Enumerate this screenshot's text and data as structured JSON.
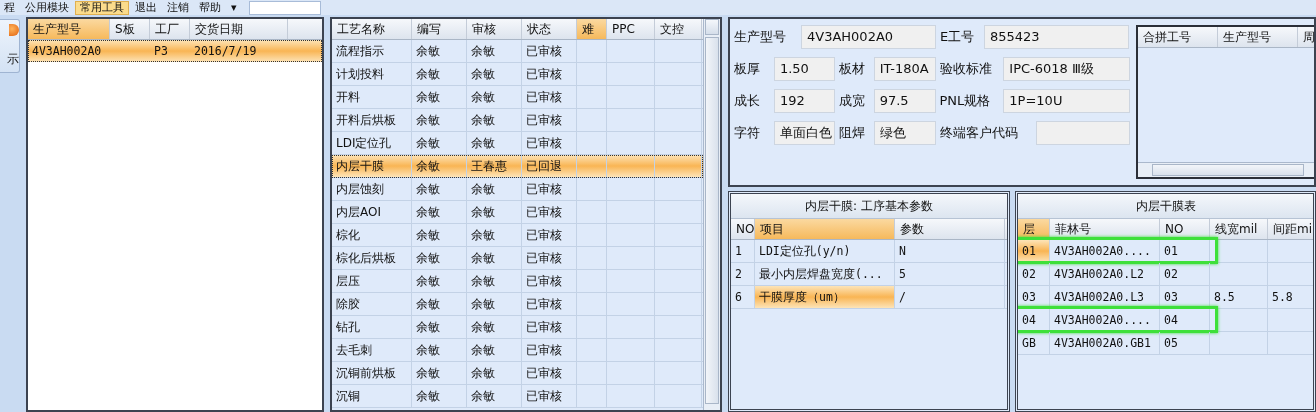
{
  "menu": {
    "items": [
      {
        "label": "程",
        "selected": false
      },
      {
        "label": "公用模块",
        "selected": false
      },
      {
        "label": "常用工具",
        "selected": true
      },
      {
        "label": "退出",
        "selected": false
      },
      {
        "label": "注销",
        "selected": false
      },
      {
        "label": "帮助",
        "selected": false
      }
    ],
    "more": "▾"
  },
  "side_button": {
    "label": "示"
  },
  "orders": {
    "columns": [
      {
        "label": "生产型号",
        "selected": true
      },
      {
        "label": "S板",
        "selected": false
      },
      {
        "label": "工厂",
        "selected": false
      },
      {
        "label": "交货日期",
        "selected": false
      }
    ],
    "rows": [
      {
        "selected": true,
        "cells": [
          "4V3AH002A0",
          "",
          "P3",
          "2016/7/19"
        ]
      }
    ]
  },
  "processes": {
    "columns": [
      {
        "label": "工艺名称",
        "selected": false
      },
      {
        "label": "编写",
        "selected": false
      },
      {
        "label": "审核",
        "selected": false
      },
      {
        "label": "状态",
        "selected": false
      },
      {
        "label": "难",
        "selected": true
      },
      {
        "label": "PPC",
        "selected": false
      },
      {
        "label": "文控",
        "selected": false
      }
    ],
    "rows": [
      {
        "selected": false,
        "cells": [
          "流程指示",
          "余敏",
          "余敏",
          "已审核"
        ]
      },
      {
        "selected": false,
        "cells": [
          "计划投料",
          "余敏",
          "余敏",
          "已审核"
        ]
      },
      {
        "selected": false,
        "cells": [
          "开料",
          "余敏",
          "余敏",
          "已审核"
        ]
      },
      {
        "selected": false,
        "cells": [
          "开料后烘板",
          "余敏",
          "余敏",
          "已审核"
        ]
      },
      {
        "selected": false,
        "cells": [
          "LDI定位孔",
          "余敏",
          "余敏",
          "已审核"
        ]
      },
      {
        "selected": true,
        "cells": [
          "内层干膜",
          "余敏",
          "王春惠",
          "已回退"
        ]
      },
      {
        "selected": false,
        "cells": [
          "内层蚀刻",
          "余敏",
          "余敏",
          "已审核"
        ]
      },
      {
        "selected": false,
        "cells": [
          "内层AOI",
          "余敏",
          "余敏",
          "已审核"
        ]
      },
      {
        "selected": false,
        "cells": [
          "棕化",
          "余敏",
          "余敏",
          "已审核"
        ]
      },
      {
        "selected": false,
        "cells": [
          "棕化后烘板",
          "余敏",
          "余敏",
          "已审核"
        ]
      },
      {
        "selected": false,
        "cells": [
          "层压",
          "余敏",
          "余敏",
          "已审核"
        ]
      },
      {
        "selected": false,
        "cells": [
          "除胶",
          "余敏",
          "余敏",
          "已审核"
        ]
      },
      {
        "selected": false,
        "cells": [
          "钻孔",
          "余敏",
          "余敏",
          "已审核"
        ]
      },
      {
        "selected": false,
        "cells": [
          "去毛刺",
          "余敏",
          "余敏",
          "已审核"
        ]
      },
      {
        "selected": false,
        "cells": [
          "沉铜前烘板",
          "余敏",
          "余敏",
          "已审核"
        ]
      },
      {
        "selected": false,
        "cells": [
          "沉铜",
          "余敏",
          "余敏",
          "已审核"
        ]
      }
    ]
  },
  "form": {
    "fields": [
      {
        "label": "生产型号",
        "value": "4V3AH002A0"
      },
      {
        "label": "E工号",
        "value": "855423"
      },
      {
        "label": "板厚",
        "value": "1.50"
      },
      {
        "label": "板材",
        "value": "IT-180A"
      },
      {
        "label": "验收标准",
        "value": "IPC-6018 Ⅲ级"
      },
      {
        "label": "成长",
        "value": "192"
      },
      {
        "label": "成宽",
        "value": "97.5"
      },
      {
        "label": "PNL规格",
        "value": "1P=10U"
      },
      {
        "label": "字符",
        "value": "单面白色"
      },
      {
        "label": "阻焊",
        "value": "绿色"
      },
      {
        "label": "终端客户代码"
      }
    ]
  },
  "merge_table": {
    "columns": [
      "合拼工号",
      "生产型号",
      "周"
    ]
  },
  "params": {
    "title": "内层干膜: 工序基本参数",
    "columns": [
      {
        "label": "NO",
        "selected": false
      },
      {
        "label": "项目",
        "selected": true
      },
      {
        "label": "参数",
        "selected": false
      }
    ],
    "rows": [
      {
        "selected": false,
        "cells": [
          "1",
          "LDI定位孔(y/n)",
          "N"
        ]
      },
      {
        "selected": false,
        "cells": [
          "2",
          "最小内层焊盘宽度(...",
          "5"
        ]
      },
      {
        "selected": true,
        "cells": [
          "6",
          "干膜厚度（um）",
          "/"
        ]
      }
    ]
  },
  "film_table": {
    "title": "内层干膜表",
    "columns": [
      {
        "label": "层",
        "selected": true
      },
      {
        "label": "菲林号",
        "selected": false
      },
      {
        "label": "NO",
        "selected": false
      },
      {
        "label": "线宽mil",
        "selected": false
      },
      {
        "label": "间距mi",
        "selected": false
      }
    ],
    "rows": [
      {
        "selected": true,
        "highlighted": true,
        "cells": [
          "01",
          "4V3AH002A0....",
          "01",
          "",
          ""
        ]
      },
      {
        "selected": false,
        "highlighted": false,
        "cells": [
          "02",
          "4V3AH002A0.L2",
          "02",
          "",
          ""
        ]
      },
      {
        "selected": false,
        "highlighted": false,
        "cells": [
          "03",
          "4V3AH002A0.L3",
          "03",
          "8.5",
          "5.8"
        ]
      },
      {
        "selected": false,
        "highlighted": true,
        "cells": [
          "04",
          "4V3AH002A0....",
          "04",
          "",
          ""
        ]
      },
      {
        "selected": false,
        "highlighted": false,
        "cells": [
          "GB",
          "4V3AH002A0.GB1",
          "05",
          "",
          ""
        ]
      }
    ]
  }
}
